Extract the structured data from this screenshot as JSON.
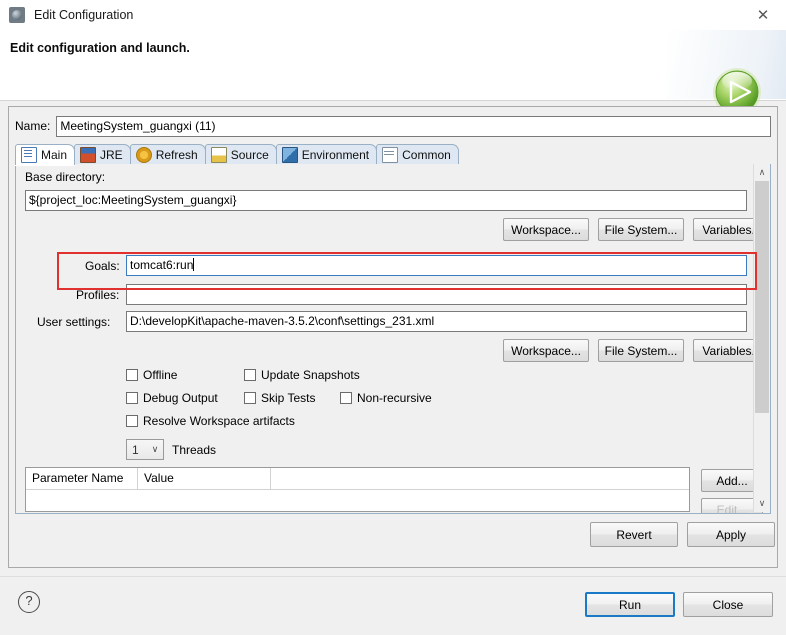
{
  "window": {
    "title": "Edit Configuration",
    "icon": "configuration-gear-icon",
    "close_label": "✕"
  },
  "header": {
    "subtitle": "Edit configuration and launch.",
    "badge_icon": "green-run-play-icon"
  },
  "name_field": {
    "label": "Name:",
    "value": "MeetingSystem_guangxi (11)",
    "placeholder": ""
  },
  "tabs": [
    {
      "label": "Main",
      "icon": "main-document-icon",
      "selected": true
    },
    {
      "label": "JRE",
      "icon": "jre-library-icon",
      "selected": false
    },
    {
      "label": "Refresh",
      "icon": "refresh-arrows-icon",
      "selected": false
    },
    {
      "label": "Source",
      "icon": "source-edit-icon",
      "selected": false
    },
    {
      "label": "Environment",
      "icon": "environment-icon",
      "selected": false
    },
    {
      "label": "Common",
      "icon": "common-window-icon",
      "selected": false
    }
  ],
  "main_tab": {
    "base_directory": {
      "label": "Base directory:",
      "value": "${project_loc:MeetingSystem_guangxi}",
      "placeholder": ""
    },
    "base_dir_buttons": [
      {
        "label": "Workspace..."
      },
      {
        "label": "File System..."
      },
      {
        "label": "Variables..."
      }
    ],
    "goals": {
      "label": "Goals:",
      "value": "tomcat6:run",
      "placeholder": "",
      "focused": true
    },
    "profiles": {
      "label": "Profiles:",
      "value": "",
      "placeholder": ""
    },
    "user_settings": {
      "label": "User settings:",
      "value": "D:\\developKit\\apache-maven-3.5.2\\conf\\settings_231.xml",
      "placeholder": ""
    },
    "user_settings_buttons": [
      {
        "label": "Workspace..."
      },
      {
        "label": "File System..."
      },
      {
        "label": "Variables..."
      }
    ],
    "checkboxes": [
      {
        "label": "Offline",
        "checked": false
      },
      {
        "label": "Update Snapshots",
        "checked": false
      },
      {
        "label": "Debug Output",
        "checked": false
      },
      {
        "label": "Skip Tests",
        "checked": false
      },
      {
        "label": "Non-recursive",
        "checked": false
      },
      {
        "label": "Resolve Workspace artifacts",
        "checked": false
      }
    ],
    "threads": {
      "value": "1",
      "label": "Threads",
      "arrow": "∨"
    },
    "parameter_table": {
      "columns": [
        "Parameter Name",
        "Value"
      ],
      "rows": []
    },
    "table_buttons": [
      {
        "label": "Add..."
      },
      {
        "label": "Edit..."
      }
    ]
  },
  "config_buttons": [
    {
      "label": "Revert"
    },
    {
      "label": "Apply"
    }
  ],
  "bottom_bar": {
    "help_icon": "help-question-icon",
    "help_glyph": "?",
    "buttons": [
      {
        "label": "Run",
        "default": true
      },
      {
        "label": "Close",
        "default": false
      }
    ]
  },
  "annotation": {
    "type": "red-rectangle-highlight",
    "target": "goals-row",
    "color": "#e03030"
  },
  "scrollbar": {
    "up_arrow": "∧",
    "down_arrow": "∨"
  }
}
